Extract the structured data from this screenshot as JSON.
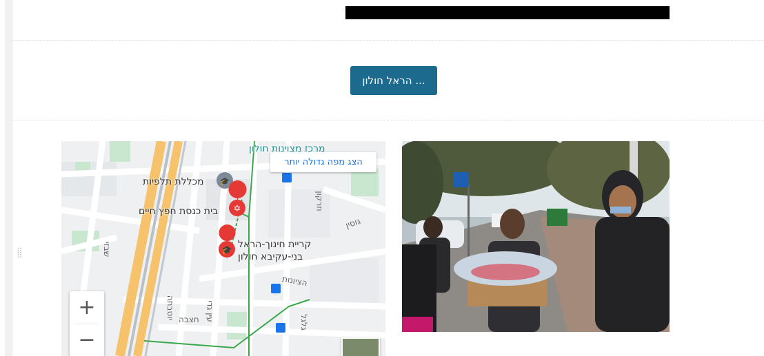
{
  "page": {
    "cta_button_label": "... הראל חולון"
  },
  "map": {
    "bigger_map_link": "הצג מפה גדולה יותר",
    "zoom_in": "+",
    "zoom_out": "−",
    "places": [
      {
        "name": "מכללת תלפיות",
        "icon": "school-grey-icon"
      },
      {
        "name": "בית כנסת חפץ חיים",
        "icon": "synagogue-icon"
      },
      {
        "name_line1": "קריית חינוך-הראל",
        "name_line2": "בני-עקיבא חולון",
        "icon": "school-red-pin-icon"
      }
    ],
    "top_label": "מרכז מצוינות חולון",
    "streets": [
      "וזרקון",
      "גוסין",
      "הציונות",
      "שבזי",
      "יוטבתה",
      "עין גדי",
      "חצבה",
      "גלגל"
    ]
  },
  "photo": {
    "alt": "students distributing packages"
  },
  "colors": {
    "cta_bg": "#1d6a8f",
    "link": "#1a73e8",
    "pin_red": "#e53935"
  }
}
